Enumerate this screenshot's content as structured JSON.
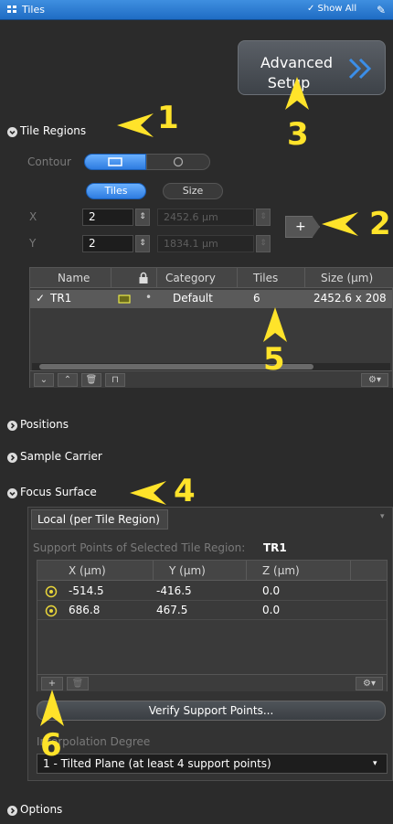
{
  "titlebar": {
    "title": "Tiles",
    "show_all": "✓ Show All"
  },
  "advanced": {
    "line1": "Advanced",
    "line2": "Setup"
  },
  "tile_regions": {
    "header": "Tile Regions",
    "contour_label": "Contour",
    "tiles_btn": "Tiles",
    "size_btn": "Size",
    "x_label": "X",
    "y_label": "Y",
    "x_value": "2",
    "y_value": "2",
    "x_size": "2452.6 µm",
    "y_size": "1834.1 µm",
    "add_btn": "+",
    "table": {
      "headers": [
        "Name",
        "Category",
        "Tiles",
        "Size (µm)"
      ],
      "row": {
        "check": "✓",
        "name": "TR1",
        "category": "Default",
        "tiles": "6",
        "size": "2452.6 x 208"
      }
    }
  },
  "sections": {
    "positions": "Positions",
    "sample_carrier": "Sample Carrier",
    "focus_surface": "Focus Surface",
    "options": "Options"
  },
  "focus": {
    "tab": "Local (per Tile Region)",
    "support_label": "Support Points of Selected Tile Region:",
    "support_region": "TR1",
    "headers": [
      "X (µm)",
      "Y (µm)",
      "Z (µm)"
    ],
    "rows": [
      {
        "x": "-514.5",
        "y": "-416.5",
        "z": "0.0"
      },
      {
        "x": "686.8",
        "y": "467.5",
        "z": "0.0"
      }
    ],
    "add_btn": "+",
    "verify_btn": "Verify Support Points...",
    "interp_label": "Interpolation Degree",
    "interp_value": "1 - Tilted Plane (at least 4 support points)"
  },
  "annotations": [
    "1",
    "2",
    "3",
    "4",
    "5",
    "6"
  ],
  "colors": {
    "accent": "#2e7ce0",
    "annotation": "#ffe32a",
    "panel": "#2b2b2b"
  }
}
